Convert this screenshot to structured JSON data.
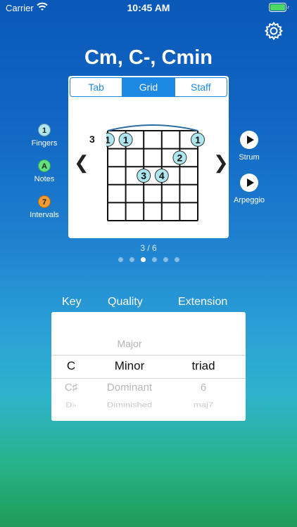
{
  "status": {
    "carrier": "Carrier",
    "time": "10:45 AM"
  },
  "chord": {
    "title": "Cm, C-, Cmin"
  },
  "tabs": [
    {
      "label": "Tab",
      "active": false
    },
    {
      "label": "Grid",
      "active": true
    },
    {
      "label": "Staff",
      "active": false
    }
  ],
  "diagram": {
    "fret_label": "3",
    "prev": "❮",
    "next": "❯",
    "dots": [
      {
        "string": 1,
        "fret": 1,
        "finger": "1"
      },
      {
        "string": 2,
        "fret": 1,
        "finger": "1"
      },
      {
        "string": 6,
        "fret": 1,
        "finger": "1"
      },
      {
        "string": 5,
        "fret": 2,
        "finger": "2"
      },
      {
        "string": 3,
        "fret": 3,
        "finger": "3"
      },
      {
        "string": 4,
        "fret": 3,
        "finger": "4"
      }
    ]
  },
  "legend": [
    {
      "badge": "1",
      "label": "Fingers",
      "color": "#aee6ef"
    },
    {
      "badge": "A",
      "label": "Notes",
      "color": "#5fe27d"
    },
    {
      "badge": "7",
      "label": "Intervals",
      "color": "#f39c32"
    }
  ],
  "actions": {
    "strum": "Strum",
    "arpeggio": "Arpeggio"
  },
  "pager": {
    "text": "3 / 6",
    "total": 6,
    "current": 3
  },
  "picker": {
    "headers": {
      "key": "Key",
      "quality": "Quality",
      "extension": "Extension"
    },
    "above": {
      "key": "",
      "quality": "Major",
      "extension": ""
    },
    "selected": {
      "key": "C",
      "quality": "Minor",
      "extension": "triad"
    },
    "below1": {
      "key": "C♯",
      "quality": "Dominant",
      "extension": "6"
    },
    "below2": {
      "key": "D♭",
      "quality": "Diminished",
      "extension": "maj7"
    }
  },
  "colors": {
    "accent": "#1e88e5",
    "finger_dot": "#aee6ef"
  }
}
